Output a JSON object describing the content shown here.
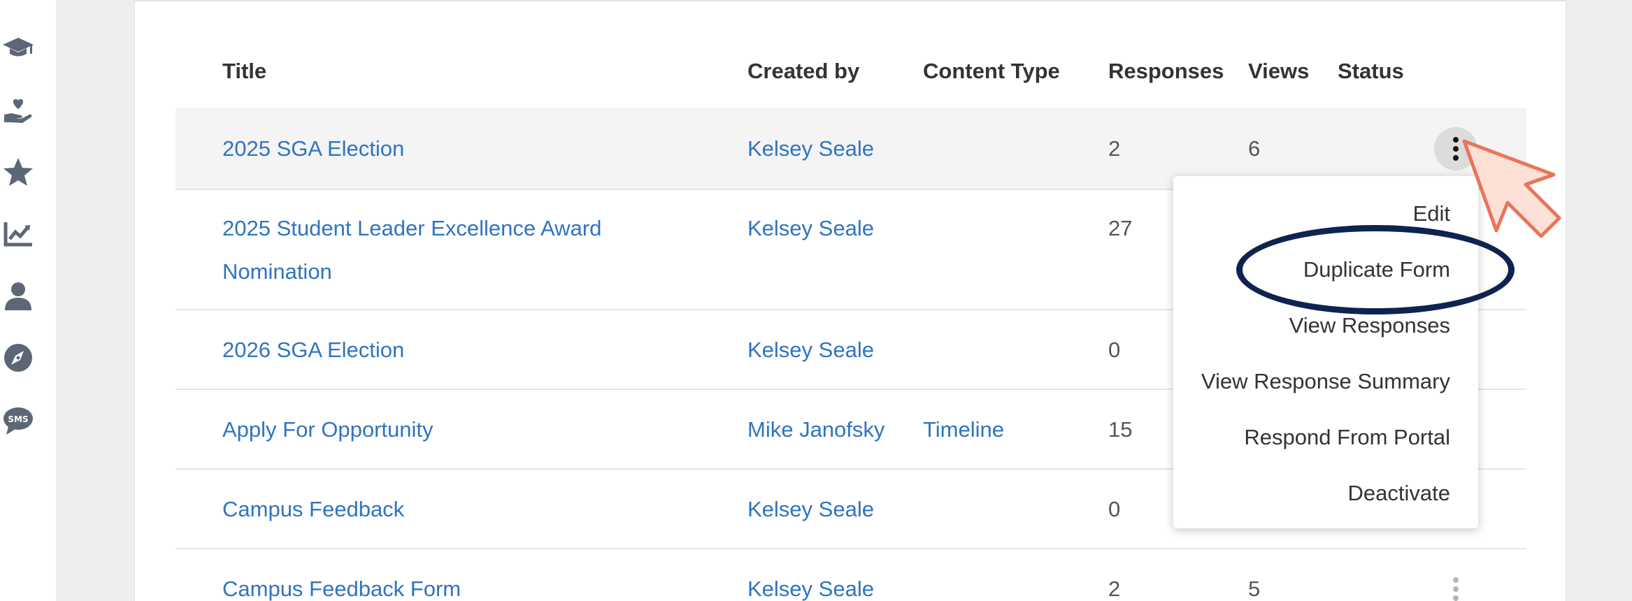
{
  "sidebar": {
    "icons": [
      "graduation-cap-icon",
      "heart-hand-icon",
      "star-icon",
      "chart-line-icon",
      "user-icon",
      "compass-icon",
      "sms-chat-icon"
    ],
    "sms_label": "SMS"
  },
  "table": {
    "headers": {
      "title": "Title",
      "created_by": "Created by",
      "content_type": "Content Type",
      "responses": "Responses",
      "views": "Views",
      "status": "Status"
    },
    "rows": [
      {
        "title": "2025 SGA Election",
        "created_by": "Kelsey Seale",
        "content_type": "",
        "responses": "2",
        "views": "6"
      },
      {
        "title": "2025 Student Leader Excellence Award",
        "title_line2": "Nomination",
        "created_by": "Kelsey Seale",
        "content_type": "",
        "responses": "27",
        "views": ""
      },
      {
        "title": "2026 SGA Election",
        "created_by": "Kelsey Seale",
        "content_type": "",
        "responses": "0",
        "views": ""
      },
      {
        "title": "Apply For Opportunity",
        "created_by": "Mike Janofsky",
        "content_type": "Timeline",
        "responses": "15",
        "views": ""
      },
      {
        "title": "Campus Feedback",
        "created_by": "Kelsey Seale",
        "content_type": "",
        "responses": "0",
        "views": ""
      },
      {
        "title": "Campus Feedback Form",
        "created_by": "Kelsey Seale",
        "content_type": "",
        "responses": "2",
        "views": "5"
      }
    ]
  },
  "menu": {
    "items": [
      "Edit",
      "Duplicate Form",
      "View Responses",
      "View Response Summary",
      "Respond From Portal",
      "Deactivate"
    ]
  },
  "colors": {
    "link": "#2f74c0",
    "highlight_ring": "#0f2350",
    "pointer_fill": "#fde0d6",
    "pointer_stroke": "#e8765a"
  }
}
